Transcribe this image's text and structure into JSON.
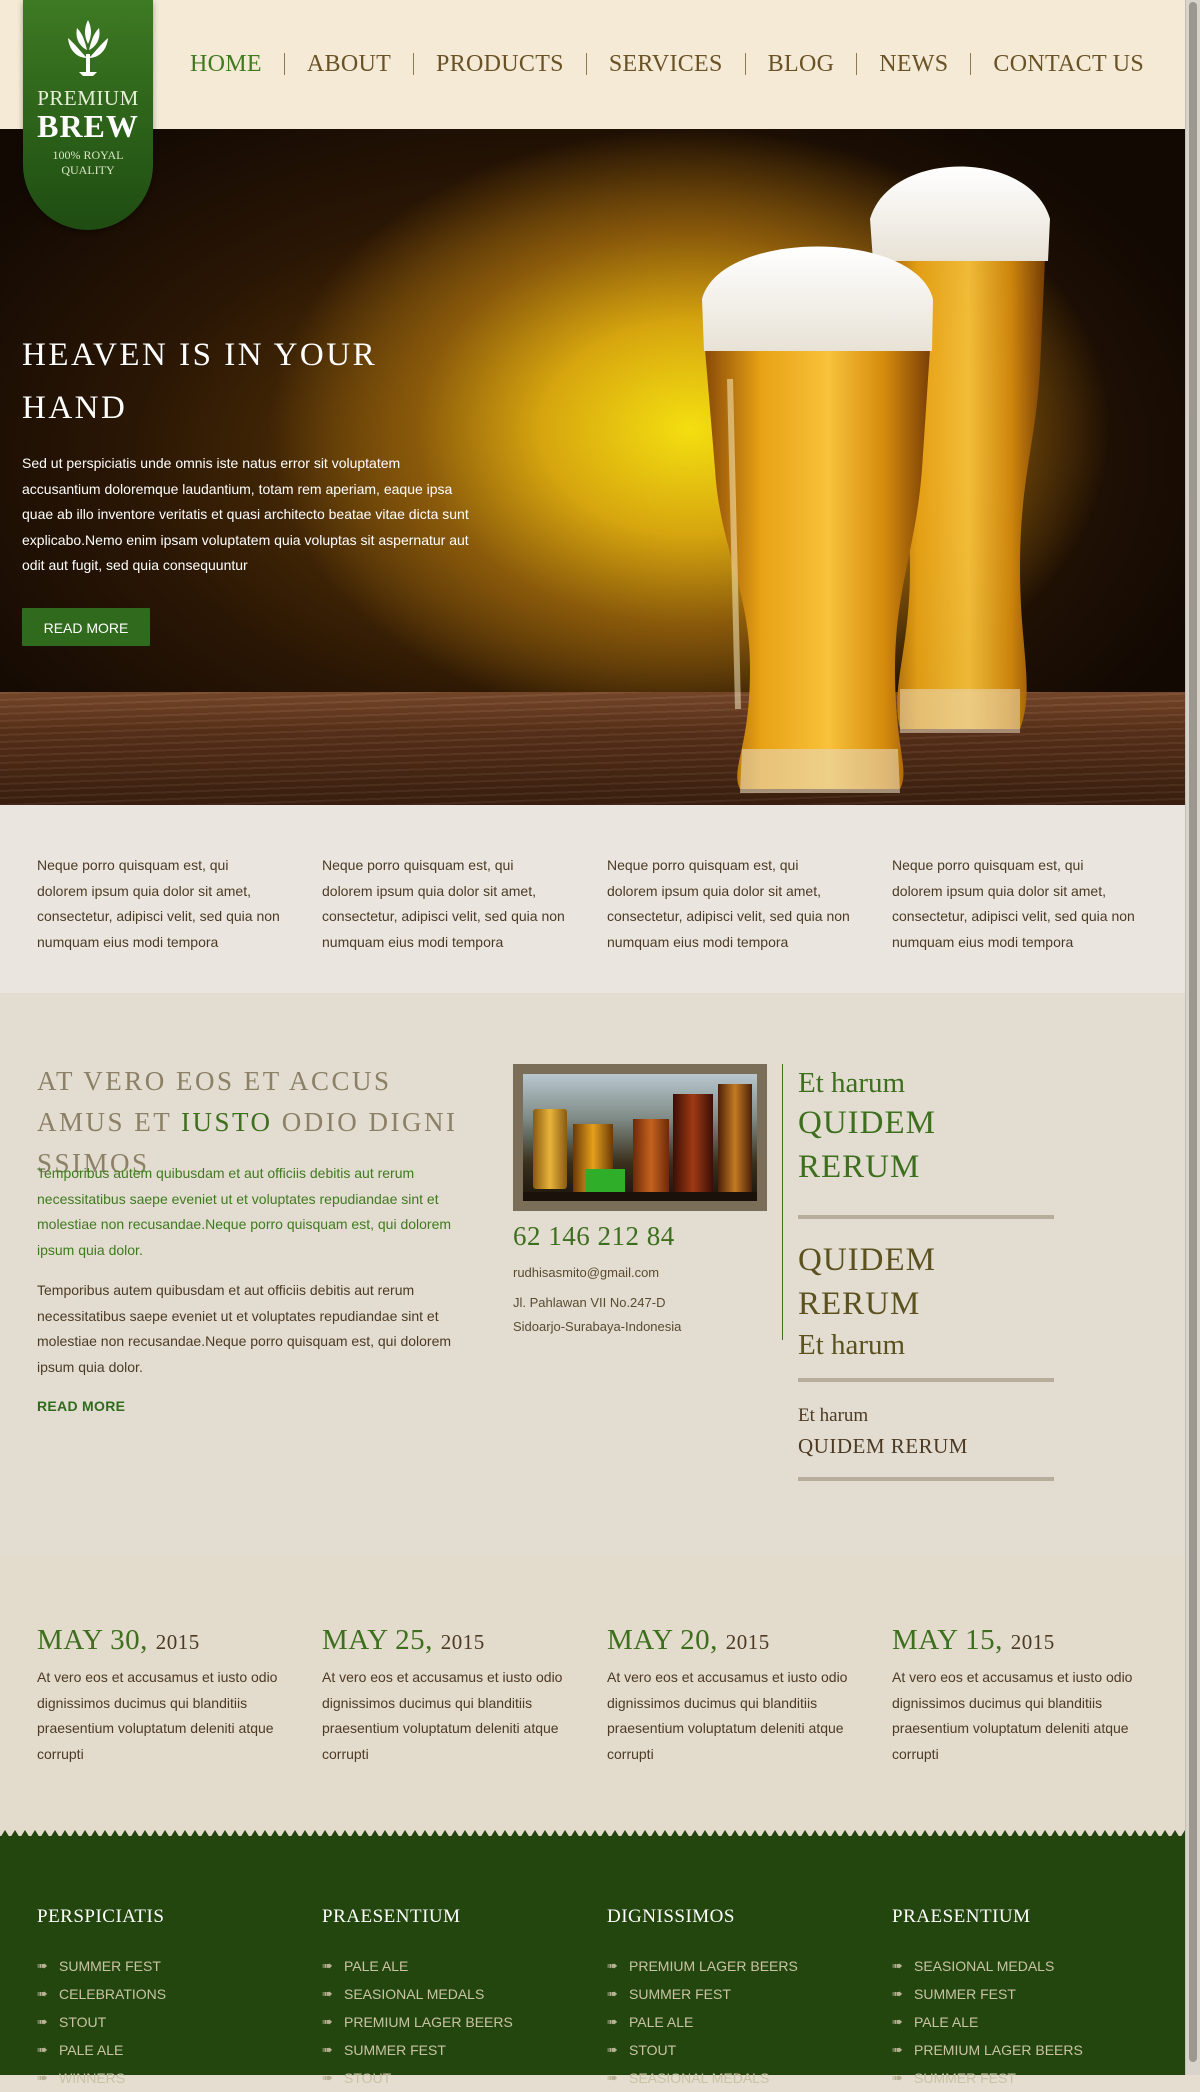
{
  "logo": {
    "line1": "PREMIUM",
    "line2": "BREW",
    "line3": "100% ROYAL QUALITY"
  },
  "nav": [
    "HOME",
    "ABOUT",
    "PRODUCTS",
    "SERVICES",
    "BLOG",
    "NEWS",
    "CONTACT US"
  ],
  "hero": {
    "title": "HEAVEN IS IN YOUR HAND",
    "text": "Sed ut perspiciatis unde omnis iste natus error sit voluptatem accusantium doloremque laudantium, totam rem aperiam, eaque ipsa quae ab illo inventore veritatis et quasi architecto beatae vitae dicta sunt explicabo.Nemo enim ipsam voluptatem quia voluptas sit aspernatur aut odit aut fugit, sed quia consequuntur",
    "button": "READ MORE"
  },
  "features": [
    "Neque porro quisquam est, qui dolorem ipsum quia dolor sit amet, consectetur, adipisci velit, sed quia non numquam eius modi tempora",
    "Neque porro quisquam est, qui dolorem ipsum quia dolor sit amet, consectetur, adipisci velit, sed quia non numquam eius modi tempora",
    "Neque porro quisquam est, qui dolorem ipsum quia dolor sit amet, consectetur, adipisci velit, sed quia non numquam eius modi tempora",
    "Neque porro quisquam est, qui dolorem ipsum quia dolor sit amet, consectetur, adipisci velit, sed quia non numquam eius modi tempora"
  ],
  "info": {
    "heading_a": "AT VERO EOS ET ACCUS AMUS ET ",
    "heading_accent": "IUSTO",
    "heading_b": " ODIO DIGNI SSIMOS",
    "para1": "Temporibus autem quibusdam et aut officiis debitis aut rerum necessitatibus saepe eveniet ut et voluptates repudiandae sint et molestiae non recusandae.Neque porro quisquam est, qui dolorem ipsum quia dolor.",
    "para2": "Temporibus autem quibusdam et aut officiis debitis aut rerum necessitatibus saepe eveniet ut et voluptates repudiandae sint et molestiae non recusandae.Neque porro quisquam est, qui dolorem ipsum quia dolor.",
    "more": "READ MORE"
  },
  "contact": {
    "phone": "62 146 212 84",
    "email": "rudhisasmito@gmail.com",
    "address1": "Jl. Pahlawan VII No.247-D",
    "address2": "Sidoarjo-Surabaya-Indonesia"
  },
  "side": {
    "b1_small": "Et harum",
    "b1_big1": "QUIDEM",
    "b1_big2": "RERUM",
    "b2_big1": "QUIDEM",
    "b2_big2": "RERUM",
    "b2_small": "Et harum",
    "b3_small": "Et harum",
    "b3_caps": "QUIDEM RERUM"
  },
  "news": [
    {
      "date": "MAY 30,",
      "year": "2015",
      "text": "At vero eos et accusamus et iusto odio dignissimos ducimus qui blanditiis praesentium voluptatum deleniti atque corrupti"
    },
    {
      "date": "MAY 25,",
      "year": "2015",
      "text": "At vero eos et accusamus et iusto odio dignissimos ducimus qui blanditiis praesentium voluptatum deleniti atque corrupti"
    },
    {
      "date": "MAY 20,",
      "year": "2015",
      "text": "At vero eos et accusamus et iusto odio dignissimos ducimus qui blanditiis praesentium voluptatum deleniti atque corrupti"
    },
    {
      "date": "MAY 15,",
      "year": "2015",
      "text": "At vero eos et accusamus et iusto odio dignissimos ducimus qui blanditiis praesentium voluptatum deleniti atque corrupti"
    }
  ],
  "footer": [
    {
      "title": "PERSPICIATIS",
      "items": [
        "SUMMER FEST",
        "CELEBRATIONS",
        "STOUT",
        "PALE ALE",
        "WINNERS"
      ]
    },
    {
      "title": "PRAESENTIUM",
      "items": [
        "PALE ALE",
        "SEASIONAL MEDALS",
        "PREMIUM LAGER BEERS",
        "SUMMER FEST",
        "STOUT"
      ]
    },
    {
      "title": "DIGNISSIMOS",
      "items": [
        "PREMIUM LAGER BEERS",
        "SUMMER FEST",
        "PALE ALE",
        "STOUT",
        "SEASIONAL MEDALS"
      ]
    },
    {
      "title": "PRAESENTIUM",
      "items": [
        "SEASIONAL MEDALS",
        "SUMMER FEST",
        "PALE ALE",
        "PREMIUM LAGER BEERS",
        "SUMMER FEST"
      ]
    }
  ],
  "icons": {
    "logo": "hop-leaf-icon",
    "footer_bullet": "arrow-icon"
  },
  "colors": {
    "brand_green": "#2f6a1d",
    "accent_green": "#3d6f1e",
    "header_bg": "#f4ead6",
    "footer_bg": "#23460f"
  }
}
